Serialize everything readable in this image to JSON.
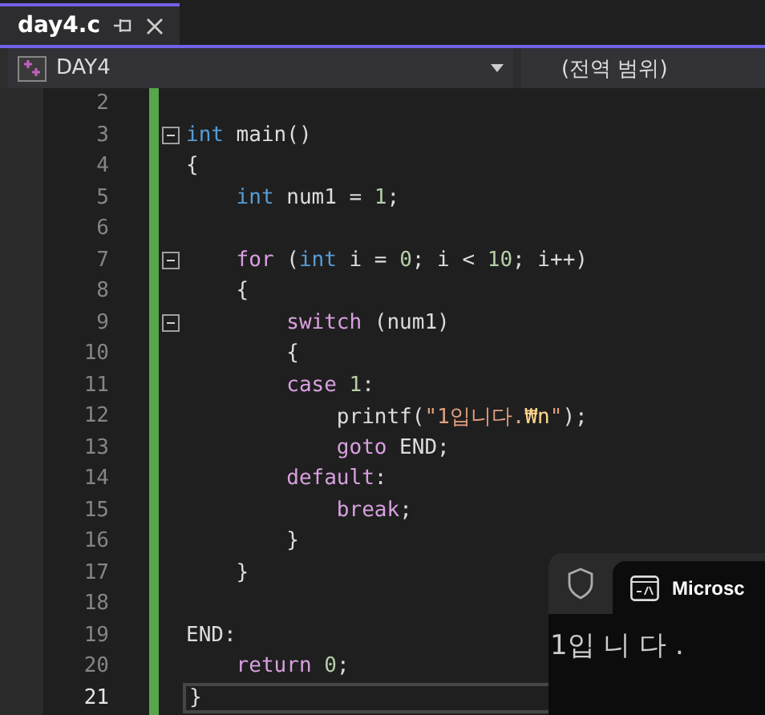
{
  "tab": {
    "label": "day4.c",
    "selected": true
  },
  "navigation": {
    "project": "DAY4",
    "scope": "(전역 범위)"
  },
  "editor": {
    "lines": [
      {
        "number": "2",
        "current": false
      },
      {
        "number": "3",
        "current": false,
        "expanded": true,
        "tokens": [
          {
            "kind": "keyword",
            "text": "int"
          },
          {
            "kind": "plain",
            "text": " main()"
          }
        ]
      },
      {
        "number": "4",
        "current": false,
        "tokens": [
          {
            "kind": "plain",
            "text": "{"
          }
        ]
      },
      {
        "number": "5",
        "current": false,
        "tokens": [
          {
            "kind": "keyword",
            "text": "    int"
          },
          {
            "kind": "plain",
            "text": " num1 = "
          },
          {
            "kind": "number",
            "text": "1"
          },
          {
            "kind": "plain",
            "text": ";"
          }
        ]
      },
      {
        "number": "6",
        "current": false
      },
      {
        "number": "7",
        "current": false,
        "expanded": true,
        "tokens": [
          {
            "kind": "control",
            "text": "    for"
          },
          {
            "kind": "plain",
            "text": " ("
          },
          {
            "kind": "keyword",
            "text": "int"
          },
          {
            "kind": "plain",
            "text": " i = "
          },
          {
            "kind": "number",
            "text": "0"
          },
          {
            "kind": "plain",
            "text": "; i < "
          },
          {
            "kind": "number",
            "text": "10"
          },
          {
            "kind": "plain",
            "text": "; i++)"
          }
        ]
      },
      {
        "number": "8",
        "current": false,
        "tokens": [
          {
            "kind": "plain",
            "text": "    {"
          }
        ]
      },
      {
        "number": "9",
        "current": false,
        "expanded": true,
        "tokens": [
          {
            "kind": "control",
            "text": "        switch"
          },
          {
            "kind": "plain",
            "text": " (num1)"
          }
        ]
      },
      {
        "number": "10",
        "current": false,
        "tokens": [
          {
            "kind": "plain",
            "text": "        {"
          }
        ]
      },
      {
        "number": "11",
        "current": false,
        "tokens": [
          {
            "kind": "control",
            "text": "        case"
          },
          {
            "kind": "number",
            "text": " 1"
          },
          {
            "kind": "plain",
            "text": ":"
          }
        ]
      },
      {
        "number": "12",
        "current": false,
        "tokens": [
          {
            "kind": "plain",
            "text": "            printf("
          },
          {
            "kind": "string",
            "text": "\"1입니다."
          },
          {
            "kind": "escape",
            "text": "₩n"
          },
          {
            "kind": "string",
            "text": "\""
          },
          {
            "kind": "plain",
            "text": ");"
          }
        ]
      },
      {
        "number": "13",
        "current": false,
        "tokens": [
          {
            "kind": "control",
            "text": "            goto"
          },
          {
            "kind": "plain",
            "text": " END;"
          }
        ]
      },
      {
        "number": "14",
        "current": false,
        "tokens": [
          {
            "kind": "control",
            "text": "        default"
          },
          {
            "kind": "plain",
            "text": ":"
          }
        ]
      },
      {
        "number": "15",
        "current": false,
        "tokens": [
          {
            "kind": "control",
            "text": "            break"
          },
          {
            "kind": "plain",
            "text": ";"
          }
        ]
      },
      {
        "number": "16",
        "current": false,
        "tokens": [
          {
            "kind": "plain",
            "text": "        }"
          }
        ]
      },
      {
        "number": "17",
        "current": false,
        "tokens": [
          {
            "kind": "plain",
            "text": "    }"
          }
        ]
      },
      {
        "number": "18",
        "current": false
      },
      {
        "number": "19",
        "current": false,
        "tokens": [
          {
            "kind": "plain",
            "text": "END:"
          }
        ]
      },
      {
        "number": "20",
        "current": false,
        "tokens": [
          {
            "kind": "control",
            "text": "    return"
          },
          {
            "kind": "number",
            "text": " 0"
          },
          {
            "kind": "plain",
            "text": ";"
          }
        ]
      },
      {
        "number": "21",
        "current": true,
        "tokens": [
          {
            "kind": "plain",
            "text": "}"
          }
        ]
      }
    ]
  },
  "terminal": {
    "tab_title": "Microsc",
    "output": "1입 니 다 ."
  }
}
